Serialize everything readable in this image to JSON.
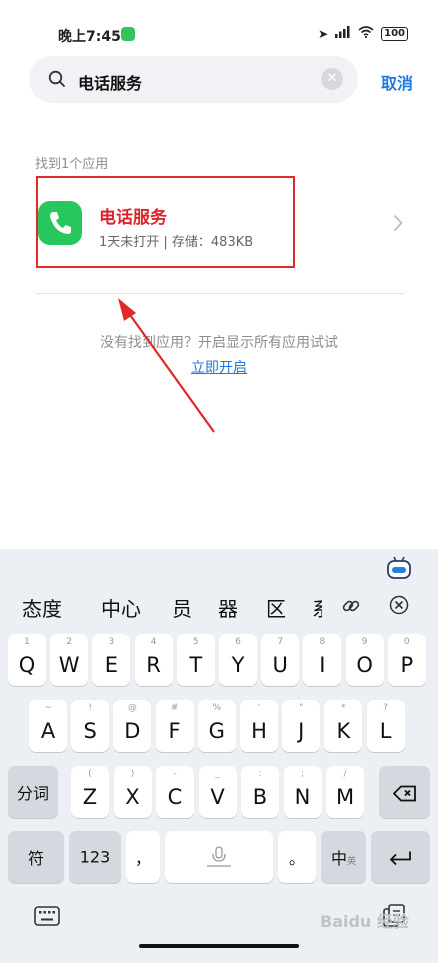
{
  "status": {
    "time": "晚上7:45",
    "battery": "100"
  },
  "search": {
    "query": "电话服务",
    "cancel": "取消"
  },
  "results": {
    "found_label": "找到1个应用",
    "app": {
      "name": "电话服务",
      "meta": "1天未打开 | 存储：483KB"
    }
  },
  "hint": {
    "text": "没有找到应用？开启显示所有应用试试",
    "link": "立即开启"
  },
  "keyboard": {
    "candidates": [
      "态度",
      "中心",
      "员",
      "器",
      "区",
      "系"
    ],
    "row1": [
      {
        "k": "Q",
        "s": "1"
      },
      {
        "k": "W",
        "s": "2"
      },
      {
        "k": "E",
        "s": "3"
      },
      {
        "k": "R",
        "s": "4"
      },
      {
        "k": "T",
        "s": "5"
      },
      {
        "k": "Y",
        "s": "6"
      },
      {
        "k": "U",
        "s": "7"
      },
      {
        "k": "I",
        "s": "8"
      },
      {
        "k": "O",
        "s": "9"
      },
      {
        "k": "P",
        "s": "0"
      }
    ],
    "row2": [
      {
        "k": "A",
        "s": "~"
      },
      {
        "k": "S",
        "s": "!"
      },
      {
        "k": "D",
        "s": "@"
      },
      {
        "k": "F",
        "s": "#"
      },
      {
        "k": "G",
        "s": "%"
      },
      {
        "k": "H",
        "s": "'"
      },
      {
        "k": "J",
        "s": "\""
      },
      {
        "k": "K",
        "s": "*"
      },
      {
        "k": "L",
        "s": "?"
      }
    ],
    "row3": [
      {
        "k": "Z",
        "s": "("
      },
      {
        "k": "X",
        "s": ")"
      },
      {
        "k": "C",
        "s": "-"
      },
      {
        "k": "V",
        "s": "_"
      },
      {
        "k": "B",
        "s": ":"
      },
      {
        "k": "N",
        "s": ";"
      },
      {
        "k": "M",
        "s": "/"
      }
    ],
    "fenci": "分词",
    "fu": "符",
    "num": "123",
    "comma": "，",
    "period": "。",
    "zhong": "中",
    "ying": "英"
  },
  "watermark": "Baidu 经验"
}
